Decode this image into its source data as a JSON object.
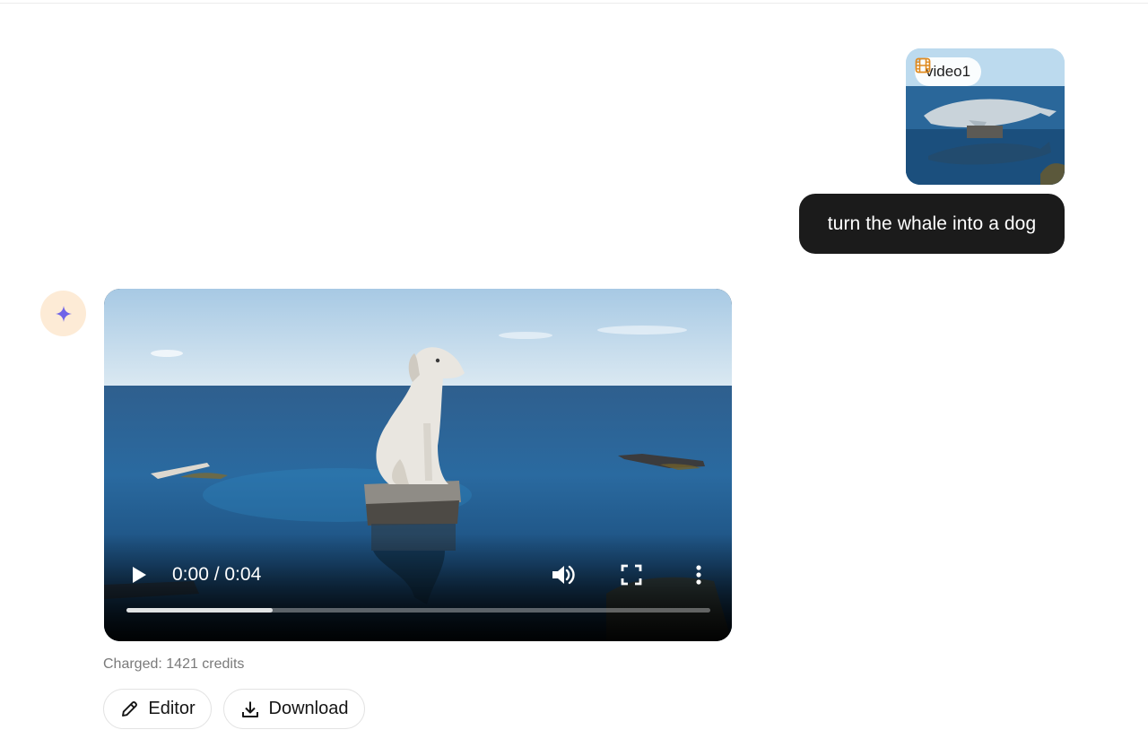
{
  "conversation": {
    "user_message": {
      "attachment": {
        "icon": "film-icon",
        "label": "video1"
      },
      "prompt": "turn the whale into a dog"
    },
    "assistant_message": {
      "avatar_icon": "sparkle-icon",
      "video": {
        "time_display": "0:00 / 0:04",
        "progress_fraction": 0.25,
        "controls": {
          "play_icon": "play-icon",
          "volume_icon": "volume-icon",
          "fullscreen_icon": "fullscreen-icon",
          "more_icon": "more-vertical-icon"
        }
      },
      "charged_text": "Charged: 1421 credits",
      "actions": {
        "editor_label": "Editor",
        "editor_icon": "pencil-icon",
        "download_label": "Download",
        "download_icon": "download-icon"
      }
    }
  },
  "colors": {
    "prompt_bubble_bg": "#1b1b1b",
    "avatar_bg": "#fdebd6",
    "sparkle": "#6f63e8",
    "film_icon": "#e08a1e"
  }
}
